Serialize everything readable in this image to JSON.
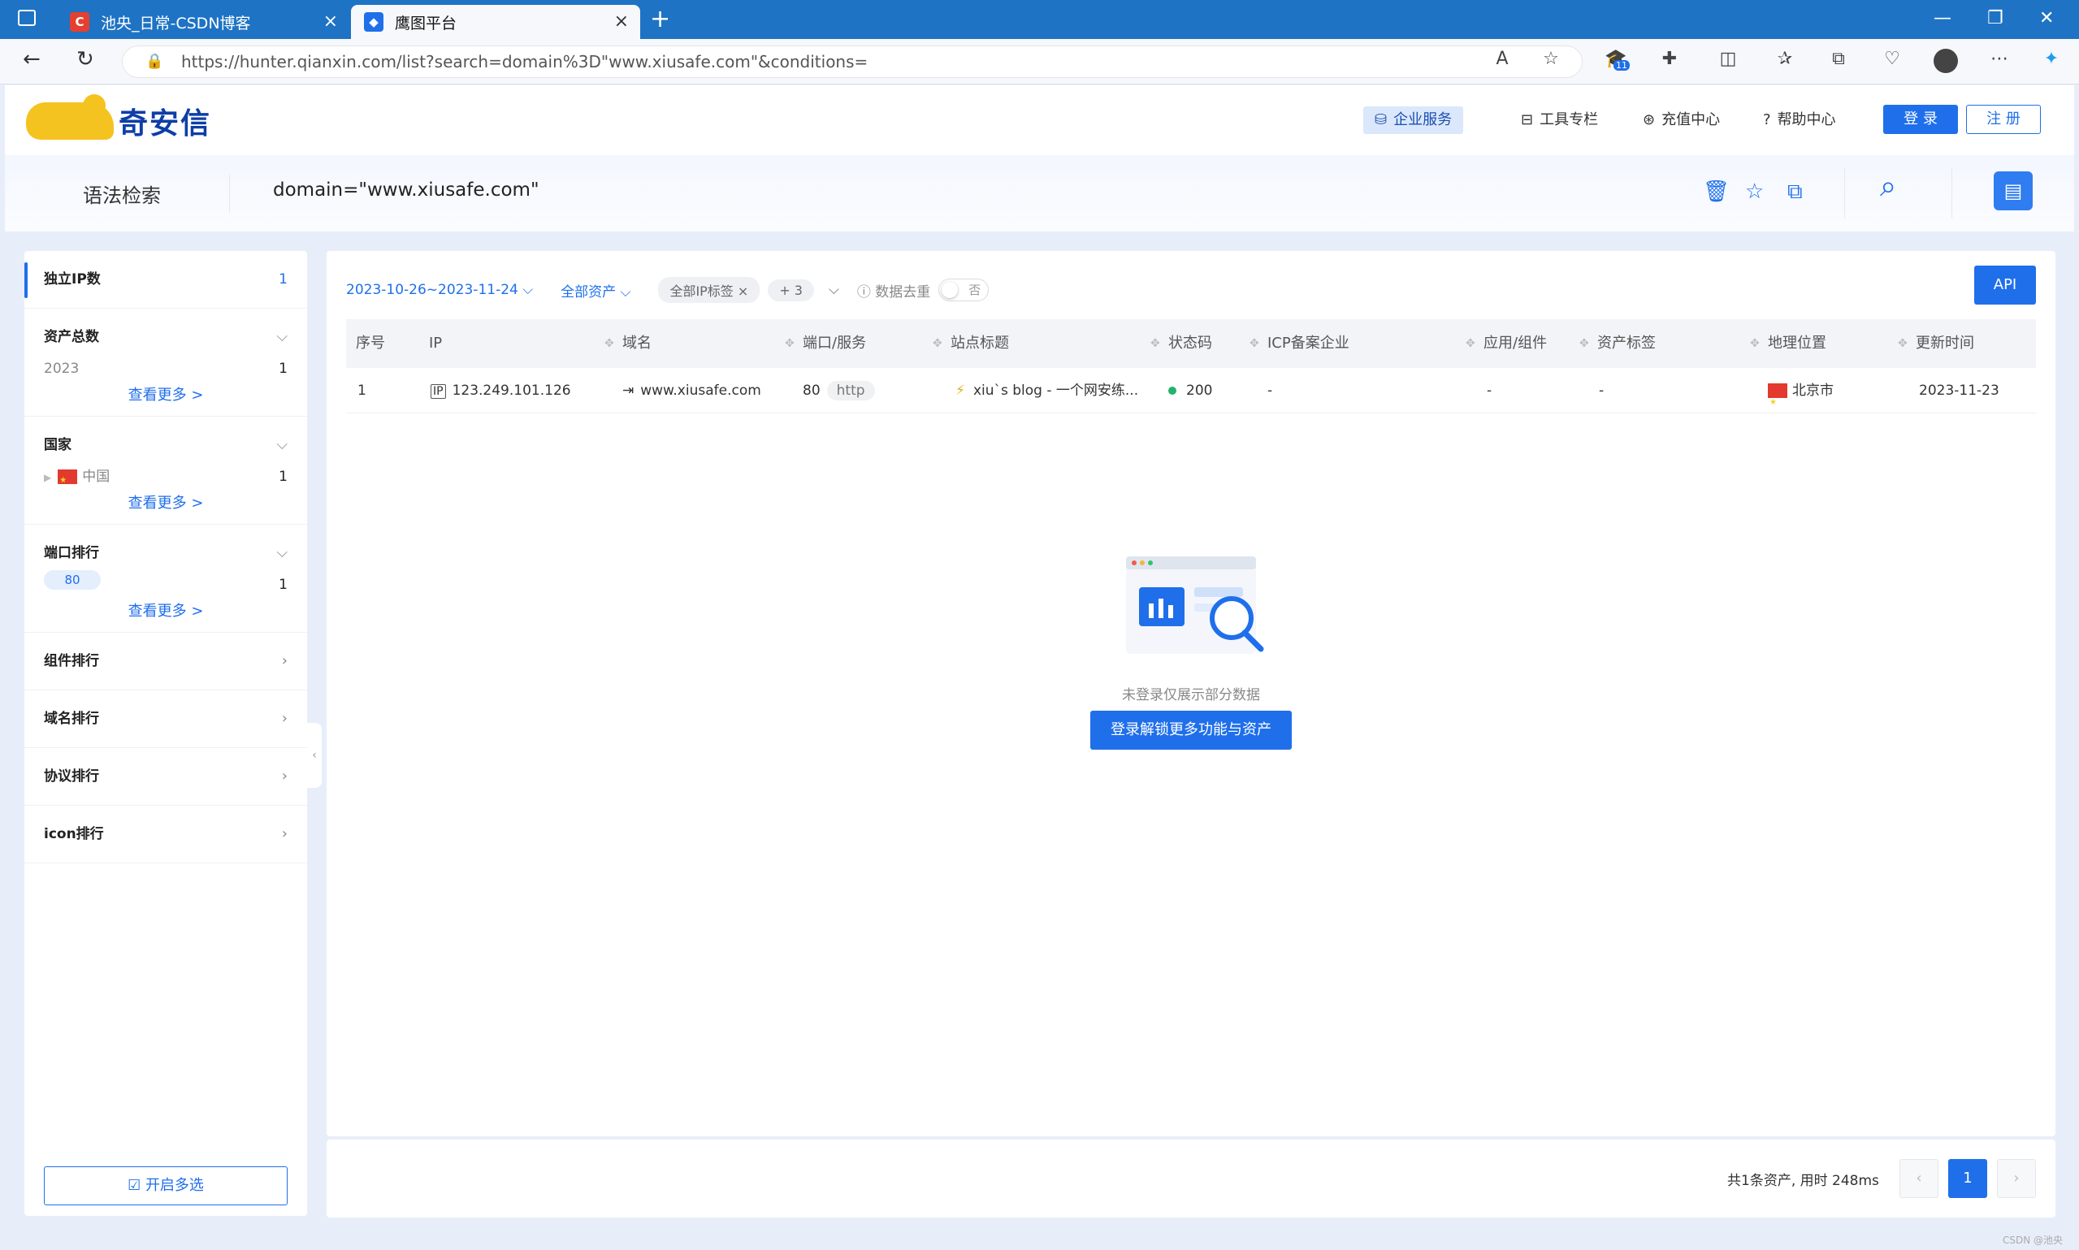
{
  "browser": {
    "tabs": [
      {
        "title": "池央_日常-CSDN博客",
        "favicon": "C"
      },
      {
        "title": "鹰图平台",
        "favicon": ""
      }
    ],
    "url": "https://hunter.qianxin.com/list?search=domain%3D\"www.xiusafe.com\"&conditions=",
    "extension_badge": "11"
  },
  "header": {
    "brand": "奇安信",
    "nav": [
      {
        "label": "企业服务",
        "icon": "enterprise-icon"
      },
      {
        "label": "工具专栏",
        "icon": "toolbox-icon"
      },
      {
        "label": "充值中心",
        "icon": "recharge-icon"
      },
      {
        "label": "帮助中心",
        "icon": "help-icon"
      }
    ],
    "login": "登 录",
    "register": "注 册"
  },
  "search": {
    "label": "语法检索",
    "query": "domain=\"www.xiusafe.com\""
  },
  "sidebar": {
    "sections": [
      {
        "title": "独立IP数",
        "count": "1"
      },
      {
        "title": "资产总数",
        "items": [
          {
            "label": "2023",
            "value": "1"
          }
        ],
        "more": "查看更多 >"
      },
      {
        "title": "国家",
        "items": [
          {
            "label": "中国",
            "value": "1"
          }
        ],
        "more": "查看更多 >"
      },
      {
        "title": "端口排行",
        "items": [
          {
            "label": "80",
            "value": "1"
          }
        ],
        "more": "查看更多 >"
      },
      {
        "title": "组件排行"
      },
      {
        "title": "域名排行"
      },
      {
        "title": "协议排行"
      },
      {
        "title": "icon排行"
      }
    ],
    "multi_select": "开启多选"
  },
  "filters": {
    "date_range": "2023-10-26~2023-11-24",
    "asset_scope": "全部资产",
    "ip_tag": "全部IP标签",
    "extra_tags": "+ 3",
    "dedup_label": "数据去重",
    "dedup_value": "否",
    "api": "API"
  },
  "table": {
    "columns": [
      "序号",
      "IP",
      "域名",
      "端口/服务",
      "站点标题",
      "状态码",
      "ICP备案企业",
      "应用/组件",
      "资产标签",
      "地理位置",
      "更新时间"
    ],
    "rows": [
      {
        "index": "1",
        "ip": "123.249.101.126",
        "domain": "www.xiusafe.com",
        "port": "80",
        "service": "http",
        "title": "xiu`s blog - 一个网安练...",
        "status": "200",
        "icp": "-",
        "app": "-",
        "tag": "-",
        "geo": "北京市",
        "updated": "2023-11-23"
      }
    ]
  },
  "empty": {
    "text": "未登录仅展示部分数据",
    "button": "登录解锁更多功能与资产"
  },
  "pagination": {
    "summary": "共1条资产,  用时 248ms",
    "current": "1"
  },
  "watermark": "CSDN @池央",
  "colors": {
    "accent": "#1f6feb",
    "chrome": "#1e73c4",
    "status_ok": "#23b26d"
  }
}
